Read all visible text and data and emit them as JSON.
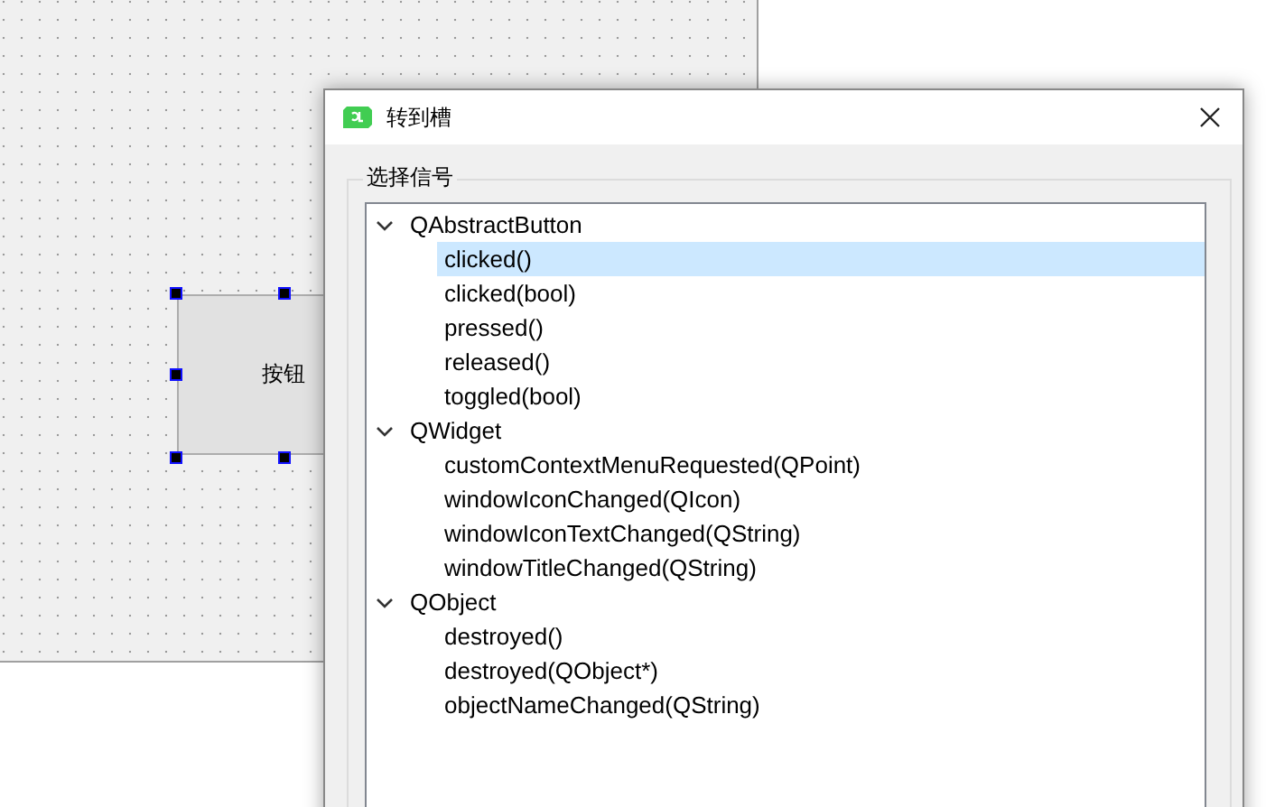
{
  "form": {
    "button_label": "按钮",
    "selected": true
  },
  "dialog": {
    "title": "转到槽",
    "group_title": "选择信号",
    "tree": [
      {
        "label": "QAbstractButton",
        "expanded": true,
        "children": [
          {
            "label": "clicked()",
            "selected": true
          },
          {
            "label": "clicked(bool)",
            "selected": false
          },
          {
            "label": "pressed()",
            "selected": false
          },
          {
            "label": "released()",
            "selected": false
          },
          {
            "label": "toggled(bool)",
            "selected": false
          }
        ]
      },
      {
        "label": "QWidget",
        "expanded": true,
        "children": [
          {
            "label": "customContextMenuRequested(QPoint)",
            "selected": false
          },
          {
            "label": "windowIconChanged(QIcon)",
            "selected": false
          },
          {
            "label": "windowIconTextChanged(QString)",
            "selected": false
          },
          {
            "label": "windowTitleChanged(QString)",
            "selected": false
          }
        ]
      },
      {
        "label": "QObject",
        "expanded": true,
        "children": [
          {
            "label": "destroyed()",
            "selected": false
          },
          {
            "label": "destroyed(QObject*)",
            "selected": false
          },
          {
            "label": "objectNameChanged(QString)",
            "selected": false
          }
        ]
      }
    ]
  }
}
